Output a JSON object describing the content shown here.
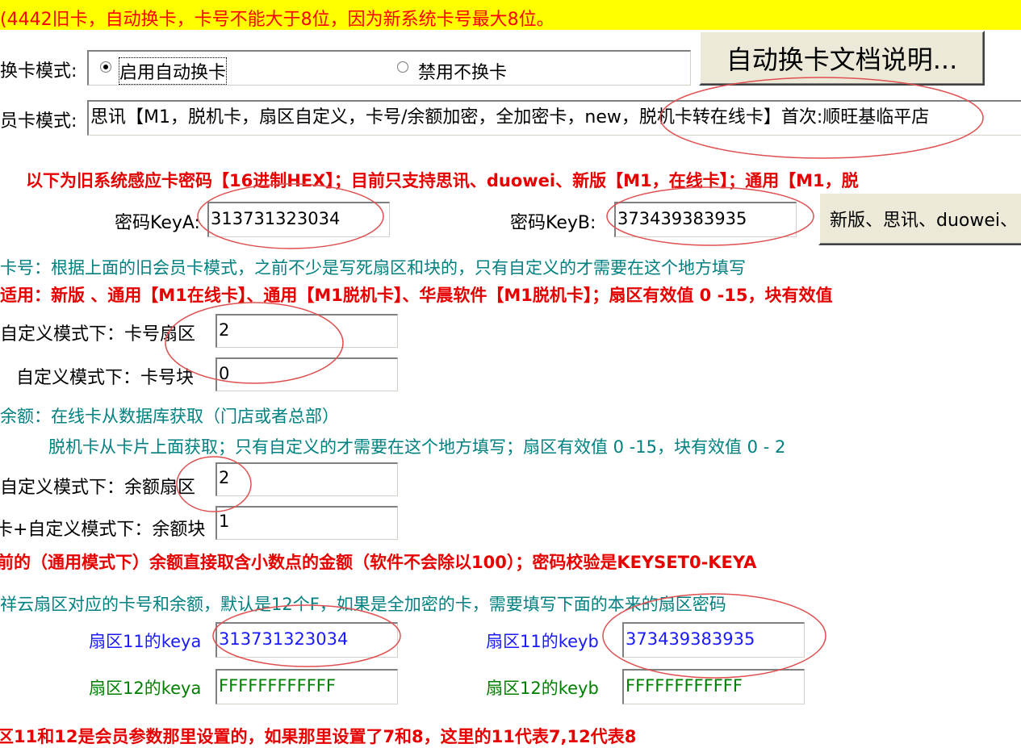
{
  "banner": {
    "text": "(4442旧卡，自动换卡，卡号不能大于8位，因为新系统卡号最大8位。"
  },
  "swap_mode": {
    "label": "换卡模式:",
    "options": [
      "启用自动换卡",
      "禁用不换卡"
    ],
    "selected": "启用自动换卡",
    "doc_button": "自动换卡文档说明..."
  },
  "member_card": {
    "label": "员卡模式:",
    "value": "思讯【M1，脱机卡，扇区自定义，卡号/余额加密，全加密卡，new，脱机卡转在线卡】首次:顺旺基临平店"
  },
  "old_password": {
    "notice": "以下为旧系统感应卡密码【16进制HEX】；目前只支持思讯、duowei、新版【M1，在线卡】；通用【M1，脱",
    "keya_label": "密码KeyA:",
    "keya_value": "313731323034",
    "keyb_label": "密码KeyB:",
    "keyb_value": "373439383935",
    "brand_button": "新版、思讯、duowei、"
  },
  "card_number": {
    "info": "卡号：根据上面的旧会员卡模式，之前不少是写死扇区和块的，只有自定义的才需要在这个地方填写",
    "applicable": "适用：新版 、通用【M1在线卡】、通用【M1脱机卡】、华晨软件【M1脱机卡】；扇区有效值 0 -15，块有效值",
    "sector_label": "自定义模式下：卡号扇区",
    "sector_value": "2",
    "block_label": "自定义模式下：卡号块",
    "block_value": "0"
  },
  "balance": {
    "info1": "余额：在线卡从数据库获取（门店或者总部）",
    "info2": "脱机卡从卡片上面获取；只有自定义的才需要在这个地方填写；扇区有效值 0 -15，块有效值 0 - 2",
    "sector_label": "自定义模式下：余额扇区",
    "sector_value": "2",
    "block_label": "卡+自定义模式下：余额块",
    "block_value": "1",
    "generic_note": "前的（通用模式下）余额直接取含小数点的金额（软件不会除以100）；密码校验是KEYSET0-KEYA"
  },
  "sector_keys": {
    "info": "祥云扇区对应的卡号和余额，默认是12个F，如果是全加密的卡，需要填写下面的本来的扇区密码",
    "s11_keya_label": "扇区11的keya",
    "s11_keya_value": "313731323034",
    "s11_keyb_label": "扇区11的keyb",
    "s11_keyb_value": "373439383935",
    "s12_keya_label": "扇区12的keya",
    "s12_keya_value": "FFFFFFFFFFFF",
    "s12_keyb_label": "扇区12的keyb",
    "s12_keyb_value": "FFFFFFFFFFFF",
    "footer_note": "区11和12是会员参数那里设置的，如果那里设置了7和8，这里的11代表7,12代表8"
  },
  "colors": {
    "banner_bg": "#ffff00",
    "red": "#e60000",
    "teal": "#008080",
    "blue": "#1a1aff",
    "green": "#008000"
  }
}
